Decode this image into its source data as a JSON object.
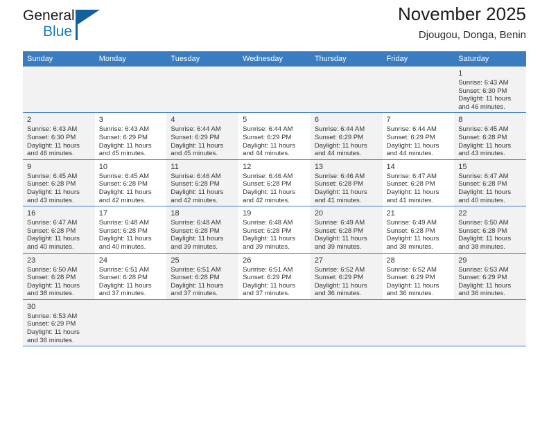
{
  "brand": {
    "name_top": "General",
    "name_bottom": "Blue",
    "accent_color": "#14619e",
    "flag_icon": "flag-triangle-icon"
  },
  "header": {
    "title": "November 2025",
    "subtitle": "Djougou, Donga, Benin"
  },
  "theme": {
    "header_row_bg": "#3a7cc0",
    "header_row_text": "#ffffff",
    "shaded_cell_bg": "#f2f2f2",
    "grid_line": "#3a7cc0",
    "body_text": "#333333"
  },
  "weekday_headers": [
    "Sunday",
    "Monday",
    "Tuesday",
    "Wednesday",
    "Thursday",
    "Friday",
    "Saturday"
  ],
  "labels": {
    "sunrise": "Sunrise:",
    "sunset": "Sunset:",
    "daylight": "Daylight:"
  },
  "weeks": [
    [
      {
        "day": "",
        "blank": true
      },
      {
        "day": "",
        "blank": true
      },
      {
        "day": "",
        "blank": true
      },
      {
        "day": "",
        "blank": true
      },
      {
        "day": "",
        "blank": true
      },
      {
        "day": "",
        "blank": true
      },
      {
        "day": "1",
        "sunrise": "Sunrise: 6:43 AM",
        "sunset": "Sunset: 6:30 PM",
        "daylight_1": "Daylight: 11 hours",
        "daylight_2": "and 46 minutes.",
        "shaded": true
      }
    ],
    [
      {
        "day": "2",
        "sunrise": "Sunrise: 6:43 AM",
        "sunset": "Sunset: 6:30 PM",
        "daylight_1": "Daylight: 11 hours",
        "daylight_2": "and 46 minutes.",
        "shaded": true
      },
      {
        "day": "3",
        "sunrise": "Sunrise: 6:43 AM",
        "sunset": "Sunset: 6:29 PM",
        "daylight_1": "Daylight: 11 hours",
        "daylight_2": "and 45 minutes.",
        "shaded": false
      },
      {
        "day": "4",
        "sunrise": "Sunrise: 6:44 AM",
        "sunset": "Sunset: 6:29 PM",
        "daylight_1": "Daylight: 11 hours",
        "daylight_2": "and 45 minutes.",
        "shaded": true
      },
      {
        "day": "5",
        "sunrise": "Sunrise: 6:44 AM",
        "sunset": "Sunset: 6:29 PM",
        "daylight_1": "Daylight: 11 hours",
        "daylight_2": "and 44 minutes.",
        "shaded": false
      },
      {
        "day": "6",
        "sunrise": "Sunrise: 6:44 AM",
        "sunset": "Sunset: 6:29 PM",
        "daylight_1": "Daylight: 11 hours",
        "daylight_2": "and 44 minutes.",
        "shaded": true
      },
      {
        "day": "7",
        "sunrise": "Sunrise: 6:44 AM",
        "sunset": "Sunset: 6:29 PM",
        "daylight_1": "Daylight: 11 hours",
        "daylight_2": "and 44 minutes.",
        "shaded": false
      },
      {
        "day": "8",
        "sunrise": "Sunrise: 6:45 AM",
        "sunset": "Sunset: 6:28 PM",
        "daylight_1": "Daylight: 11 hours",
        "daylight_2": "and 43 minutes.",
        "shaded": true
      }
    ],
    [
      {
        "day": "9",
        "sunrise": "Sunrise: 6:45 AM",
        "sunset": "Sunset: 6:28 PM",
        "daylight_1": "Daylight: 11 hours",
        "daylight_2": "and 43 minutes.",
        "shaded": true
      },
      {
        "day": "10",
        "sunrise": "Sunrise: 6:45 AM",
        "sunset": "Sunset: 6:28 PM",
        "daylight_1": "Daylight: 11 hours",
        "daylight_2": "and 42 minutes.",
        "shaded": false
      },
      {
        "day": "11",
        "sunrise": "Sunrise: 6:46 AM",
        "sunset": "Sunset: 6:28 PM",
        "daylight_1": "Daylight: 11 hours",
        "daylight_2": "and 42 minutes.",
        "shaded": true
      },
      {
        "day": "12",
        "sunrise": "Sunrise: 6:46 AM",
        "sunset": "Sunset: 6:28 PM",
        "daylight_1": "Daylight: 11 hours",
        "daylight_2": "and 42 minutes.",
        "shaded": false
      },
      {
        "day": "13",
        "sunrise": "Sunrise: 6:46 AM",
        "sunset": "Sunset: 6:28 PM",
        "daylight_1": "Daylight: 11 hours",
        "daylight_2": "and 41 minutes.",
        "shaded": true
      },
      {
        "day": "14",
        "sunrise": "Sunrise: 6:47 AM",
        "sunset": "Sunset: 6:28 PM",
        "daylight_1": "Daylight: 11 hours",
        "daylight_2": "and 41 minutes.",
        "shaded": false
      },
      {
        "day": "15",
        "sunrise": "Sunrise: 6:47 AM",
        "sunset": "Sunset: 6:28 PM",
        "daylight_1": "Daylight: 11 hours",
        "daylight_2": "and 40 minutes.",
        "shaded": true
      }
    ],
    [
      {
        "day": "16",
        "sunrise": "Sunrise: 6:47 AM",
        "sunset": "Sunset: 6:28 PM",
        "daylight_1": "Daylight: 11 hours",
        "daylight_2": "and 40 minutes.",
        "shaded": true
      },
      {
        "day": "17",
        "sunrise": "Sunrise: 6:48 AM",
        "sunset": "Sunset: 6:28 PM",
        "daylight_1": "Daylight: 11 hours",
        "daylight_2": "and 40 minutes.",
        "shaded": false
      },
      {
        "day": "18",
        "sunrise": "Sunrise: 6:48 AM",
        "sunset": "Sunset: 6:28 PM",
        "daylight_1": "Daylight: 11 hours",
        "daylight_2": "and 39 minutes.",
        "shaded": true
      },
      {
        "day": "19",
        "sunrise": "Sunrise: 6:48 AM",
        "sunset": "Sunset: 6:28 PM",
        "daylight_1": "Daylight: 11 hours",
        "daylight_2": "and 39 minutes.",
        "shaded": false
      },
      {
        "day": "20",
        "sunrise": "Sunrise: 6:49 AM",
        "sunset": "Sunset: 6:28 PM",
        "daylight_1": "Daylight: 11 hours",
        "daylight_2": "and 39 minutes.",
        "shaded": true
      },
      {
        "day": "21",
        "sunrise": "Sunrise: 6:49 AM",
        "sunset": "Sunset: 6:28 PM",
        "daylight_1": "Daylight: 11 hours",
        "daylight_2": "and 38 minutes.",
        "shaded": false
      },
      {
        "day": "22",
        "sunrise": "Sunrise: 6:50 AM",
        "sunset": "Sunset: 6:28 PM",
        "daylight_1": "Daylight: 11 hours",
        "daylight_2": "and 38 minutes.",
        "shaded": true
      }
    ],
    [
      {
        "day": "23",
        "sunrise": "Sunrise: 6:50 AM",
        "sunset": "Sunset: 6:28 PM",
        "daylight_1": "Daylight: 11 hours",
        "daylight_2": "and 38 minutes.",
        "shaded": true
      },
      {
        "day": "24",
        "sunrise": "Sunrise: 6:51 AM",
        "sunset": "Sunset: 6:28 PM",
        "daylight_1": "Daylight: 11 hours",
        "daylight_2": "and 37 minutes.",
        "shaded": false
      },
      {
        "day": "25",
        "sunrise": "Sunrise: 6:51 AM",
        "sunset": "Sunset: 6:28 PM",
        "daylight_1": "Daylight: 11 hours",
        "daylight_2": "and 37 minutes.",
        "shaded": true
      },
      {
        "day": "26",
        "sunrise": "Sunrise: 6:51 AM",
        "sunset": "Sunset: 6:29 PM",
        "daylight_1": "Daylight: 11 hours",
        "daylight_2": "and 37 minutes.",
        "shaded": false
      },
      {
        "day": "27",
        "sunrise": "Sunrise: 6:52 AM",
        "sunset": "Sunset: 6:29 PM",
        "daylight_1": "Daylight: 11 hours",
        "daylight_2": "and 36 minutes.",
        "shaded": true
      },
      {
        "day": "28",
        "sunrise": "Sunrise: 6:52 AM",
        "sunset": "Sunset: 6:29 PM",
        "daylight_1": "Daylight: 11 hours",
        "daylight_2": "and 36 minutes.",
        "shaded": false
      },
      {
        "day": "29",
        "sunrise": "Sunrise: 6:53 AM",
        "sunset": "Sunset: 6:29 PM",
        "daylight_1": "Daylight: 11 hours",
        "daylight_2": "and 36 minutes.",
        "shaded": true
      }
    ],
    [
      {
        "day": "30",
        "sunrise": "Sunrise: 6:53 AM",
        "sunset": "Sunset: 6:29 PM",
        "daylight_1": "Daylight: 11 hours",
        "daylight_2": "and 36 minutes.",
        "shaded": true
      },
      {
        "day": "",
        "blank": true
      },
      {
        "day": "",
        "blank": true
      },
      {
        "day": "",
        "blank": true
      },
      {
        "day": "",
        "blank": true
      },
      {
        "day": "",
        "blank": true
      },
      {
        "day": "",
        "blank": true
      }
    ]
  ]
}
